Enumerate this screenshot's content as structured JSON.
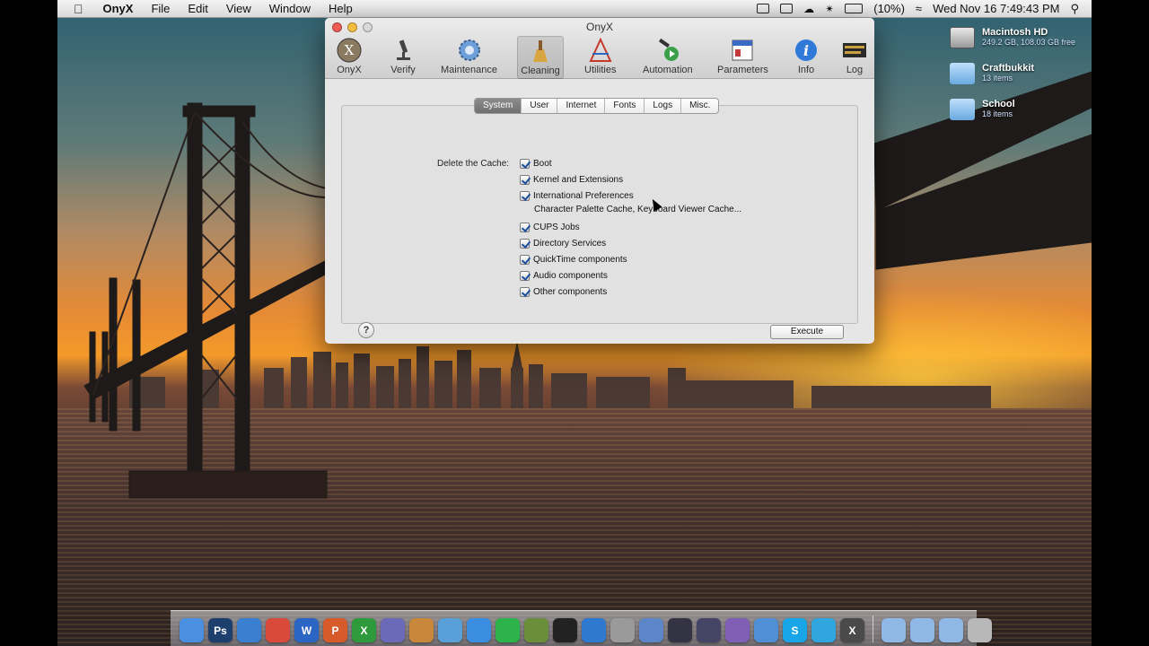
{
  "menubar": {
    "app_name": "OnyX",
    "menus": [
      "File",
      "Edit",
      "View",
      "Window",
      "Help"
    ],
    "battery": "(10%)",
    "clock": "Wed Nov 16  7:49:43 PM"
  },
  "desktop": {
    "items": [
      {
        "name": "Macintosh HD",
        "info": "249.2 GB, 108.03 GB free",
        "icon": "hard-drive-icon"
      },
      {
        "name": "Craftbukkit",
        "info": "13 items",
        "icon": "folder-icon"
      },
      {
        "name": "School",
        "info": "18 items",
        "icon": "folder-icon"
      }
    ]
  },
  "window": {
    "title": "OnyX",
    "toolbar": [
      {
        "label": "OnyX",
        "icon": "onyx-x-icon"
      },
      {
        "label": "Verify",
        "icon": "microscope-icon"
      },
      {
        "label": "Maintenance",
        "icon": "gear-icon"
      },
      {
        "label": "Cleaning",
        "icon": "broom-icon",
        "selected": true
      },
      {
        "label": "Utilities",
        "icon": "utilities-icon"
      },
      {
        "label": "Automation",
        "icon": "automation-icon"
      },
      {
        "label": "Parameters",
        "icon": "parameters-icon"
      },
      {
        "label": "Info",
        "icon": "info-icon"
      },
      {
        "label": "Log",
        "icon": "log-icon"
      }
    ],
    "tabs": [
      "System",
      "User",
      "Internet",
      "Fonts",
      "Logs",
      "Misc."
    ],
    "active_tab": "System",
    "cache_label": "Delete the Cache:",
    "options": [
      {
        "label": "Boot",
        "checked": true
      },
      {
        "label": "Kernel and Extensions",
        "checked": true
      },
      {
        "label": "International Preferences",
        "checked": true
      },
      {
        "label": "CUPS Jobs",
        "checked": true
      },
      {
        "label": "Directory Services",
        "checked": true
      },
      {
        "label": "QuickTime components",
        "checked": true
      },
      {
        "label": "Audio components",
        "checked": true
      },
      {
        "label": "Other components",
        "checked": true
      }
    ],
    "sub_note": "Character Palette Cache, Keyboard Viewer Cache...",
    "help_label": "?",
    "execute_label": "Execute"
  },
  "dock": {
    "apps": [
      {
        "name": "finder-icon",
        "color": "#4a8fe0",
        "glyph": ""
      },
      {
        "name": "photoshop-icon",
        "color": "#1d3f6e",
        "glyph": "Ps"
      },
      {
        "name": "safari-icon",
        "color": "#3b7fd0",
        "glyph": ""
      },
      {
        "name": "chrome-icon",
        "color": "#d94a3a",
        "glyph": ""
      },
      {
        "name": "word-icon",
        "color": "#2b66c4",
        "glyph": "W"
      },
      {
        "name": "powerpoint-icon",
        "color": "#d65a2a",
        "glyph": "P"
      },
      {
        "name": "excel-icon",
        "color": "#2f9a3c",
        "glyph": "X"
      },
      {
        "name": "brush-icon",
        "color": "#6a6ab8",
        "glyph": ""
      },
      {
        "name": "preview-icon",
        "color": "#c8873a",
        "glyph": ""
      },
      {
        "name": "photos-icon",
        "color": "#5aa0d8",
        "glyph": ""
      },
      {
        "name": "itunes-icon",
        "color": "#3a8de0",
        "glyph": ""
      },
      {
        "name": "spotify-icon",
        "color": "#2cb34a",
        "glyph": ""
      },
      {
        "name": "minecraft-icon",
        "color": "#6b8e3a",
        "glyph": ""
      },
      {
        "name": "terminal-icon",
        "color": "#222222",
        "glyph": ""
      },
      {
        "name": "network-icon",
        "color": "#2f7ad0",
        "glyph": ""
      },
      {
        "name": "utility-icon",
        "color": "#9a9a9a",
        "glyph": ""
      },
      {
        "name": "preview-doc-icon",
        "color": "#5d86c9",
        "glyph": ""
      },
      {
        "name": "clapper-icon",
        "color": "#333344",
        "glyph": ""
      },
      {
        "name": "video-icon",
        "color": "#444466",
        "glyph": ""
      },
      {
        "name": "dvd-icon",
        "color": "#7e5fb5",
        "glyph": ""
      },
      {
        "name": "messages-icon",
        "color": "#4f8fd6",
        "glyph": ""
      },
      {
        "name": "skype-icon",
        "color": "#19a6e8",
        "glyph": "S"
      },
      {
        "name": "twitter-icon",
        "color": "#2fa7de",
        "glyph": ""
      },
      {
        "name": "onyx-icon",
        "color": "#4a4a4a",
        "glyph": "X"
      },
      {
        "name": "separator",
        "color": "",
        "glyph": ""
      },
      {
        "name": "applications-folder-icon",
        "color": "#8fb8e6",
        "glyph": ""
      },
      {
        "name": "documents-folder-icon",
        "color": "#8fb8e6",
        "glyph": ""
      },
      {
        "name": "downloads-folder-icon",
        "color": "#8fb8e6",
        "glyph": ""
      },
      {
        "name": "trash-icon",
        "color": "#b8b8b8",
        "glyph": ""
      }
    ]
  }
}
